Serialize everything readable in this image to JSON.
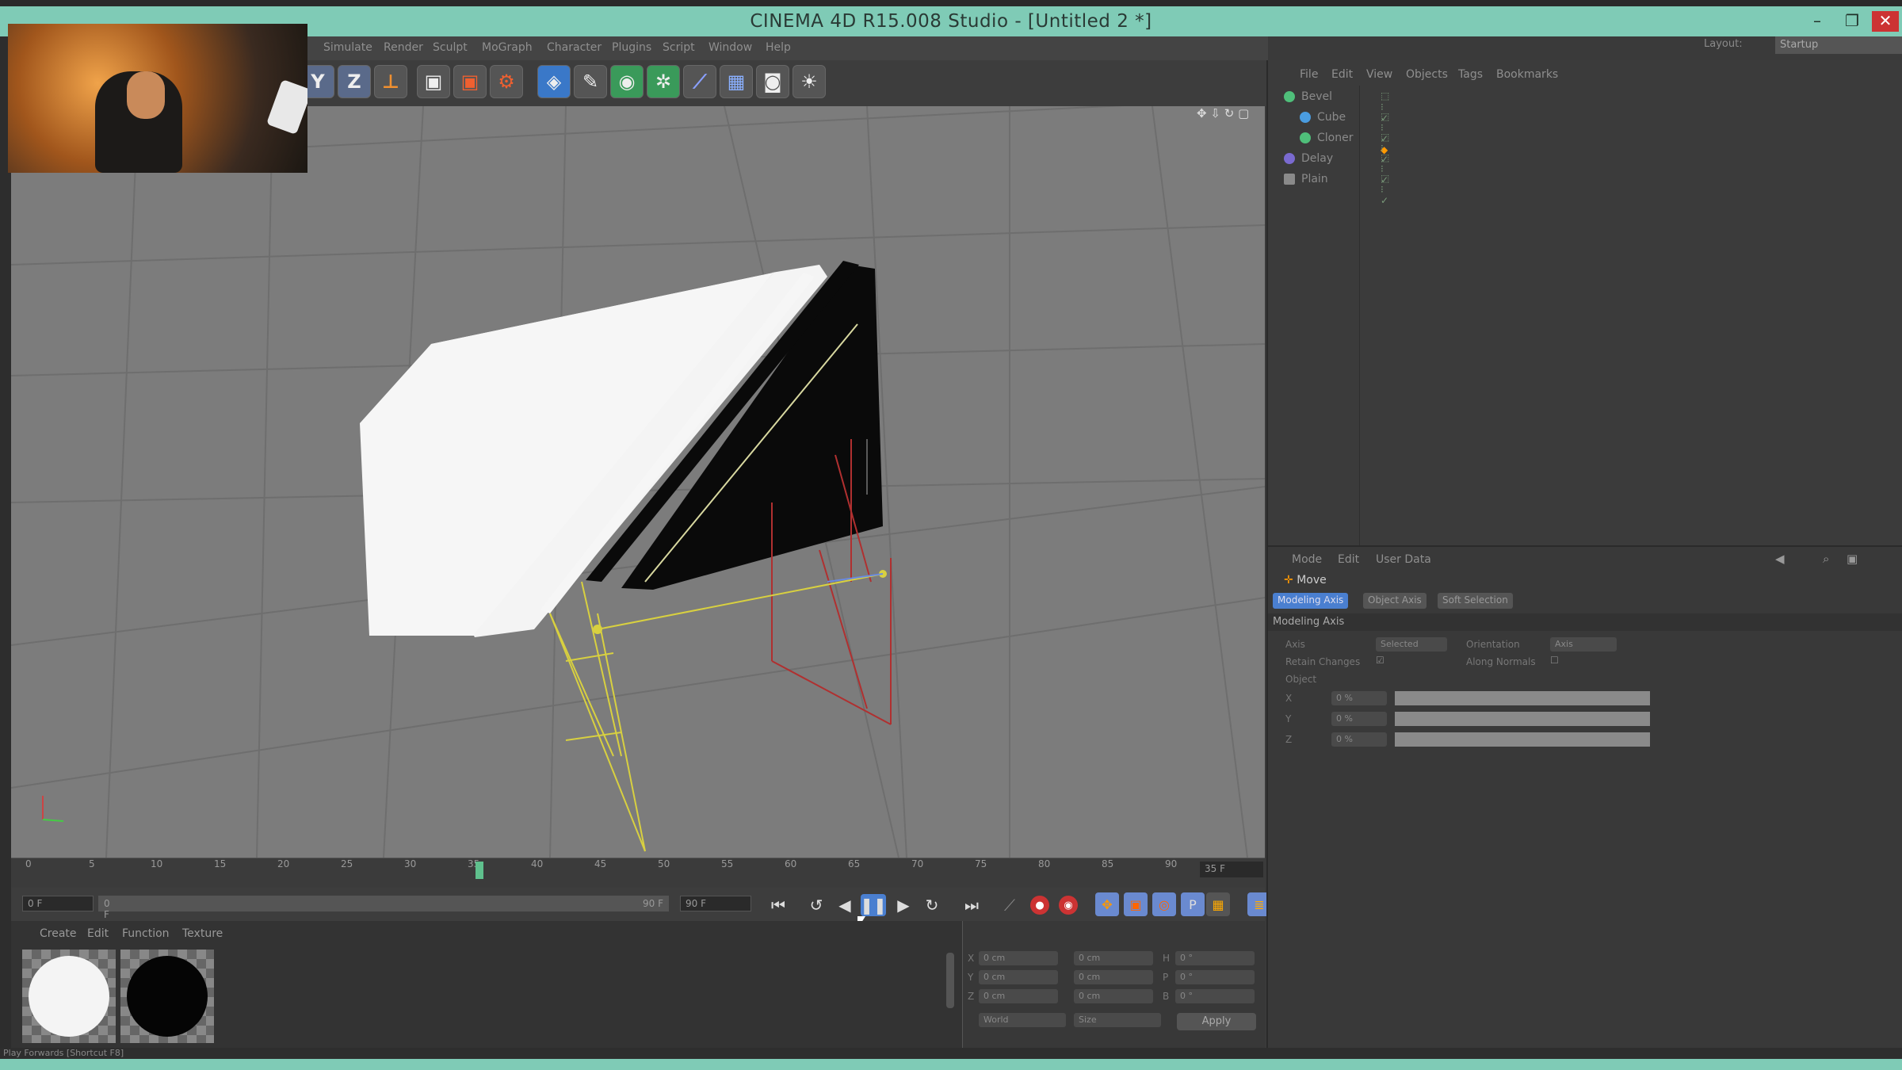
{
  "window": {
    "title": "CINEMA 4D R15.008 Studio - [Untitled 2 *]"
  },
  "menubar": {
    "items": [
      "Simulate",
      "Render",
      "Sculpt",
      "MoGraph",
      "Character",
      "Plugins",
      "Script",
      "Window",
      "Help"
    ]
  },
  "layout": {
    "label": "Layout:",
    "value": "Startup"
  },
  "toolbar": {
    "icons": [
      "axis-y-icon",
      "axis-z-icon",
      "coordinate-system-icon",
      "render-view-icon",
      "render-picture-queue-icon",
      "render-settings-icon",
      "cube-primitive-icon",
      "spline-pen-icon",
      "nurbs-subdivision-icon",
      "array-cloner-icon",
      "deformer-bend-icon",
      "scene-floor-icon",
      "camera-icon",
      "light-icon"
    ]
  },
  "timeline": {
    "ticks": [
      "0",
      "5",
      "10",
      "15",
      "20",
      "25",
      "30",
      "35",
      "40",
      "45",
      "50",
      "55",
      "60",
      "65",
      "70",
      "75",
      "80",
      "85",
      "90"
    ],
    "current_frame": 35,
    "max_frame": 90,
    "end_label": "35 F"
  },
  "transport": {
    "start": "0 F",
    "min": "0 F",
    "max": "90 F",
    "end": "90 F"
  },
  "materials": {
    "menu": [
      "Create",
      "Edit",
      "Function",
      "Texture"
    ],
    "items": [
      {
        "color": "#f4f4f4"
      },
      {
        "color": "#050505"
      }
    ]
  },
  "coords": {
    "rows": [
      {
        "axis": "X",
        "pos": "0 cm",
        "size": "0 cm",
        "rot_label": "H",
        "rot": "0 °"
      },
      {
        "axis": "Y",
        "pos": "0 cm",
        "size": "0 cm",
        "rot_label": "P",
        "rot": "0 °"
      },
      {
        "axis": "Z",
        "pos": "0 cm",
        "size": "0 cm",
        "rot_label": "B",
        "rot": "0 °"
      }
    ],
    "mode_world": "World",
    "mode_size": "Size",
    "apply": "Apply"
  },
  "object_manager": {
    "menu": [
      "File",
      "Edit",
      "View",
      "Objects",
      "Tags",
      "Bookmarks"
    ],
    "objects": [
      {
        "name": "Bevel",
        "color": "#4fbf7a"
      },
      {
        "name": "Cube",
        "color": "#4a9ce0"
      },
      {
        "name": "Cloner",
        "color": "#4fbf7a"
      },
      {
        "name": "Delay",
        "color": "#7a6ad0"
      },
      {
        "name": "Plain",
        "color": "#8a8a8a"
      }
    ]
  },
  "attributes": {
    "menu": [
      "Mode",
      "Edit",
      "User Data"
    ],
    "title": "Move",
    "tabs": [
      "Modeling Axis",
      "Object Axis",
      "Soft Selection"
    ],
    "section": "Modeling Axis",
    "axis_label": "Axis",
    "axis_value": "Selected",
    "orientation_label": "Orientation",
    "orientation_value": "Axis",
    "retain_label": "Retain Changes",
    "along_label": "Along Normals",
    "object_label": "Object",
    "xyz": [
      {
        "axis": "X",
        "val": "0 %"
      },
      {
        "axis": "Y",
        "val": "0 %"
      },
      {
        "axis": "Z",
        "val": "0 %"
      }
    ]
  },
  "status": {
    "text": "Play Forwards [Shortcut F8]"
  }
}
